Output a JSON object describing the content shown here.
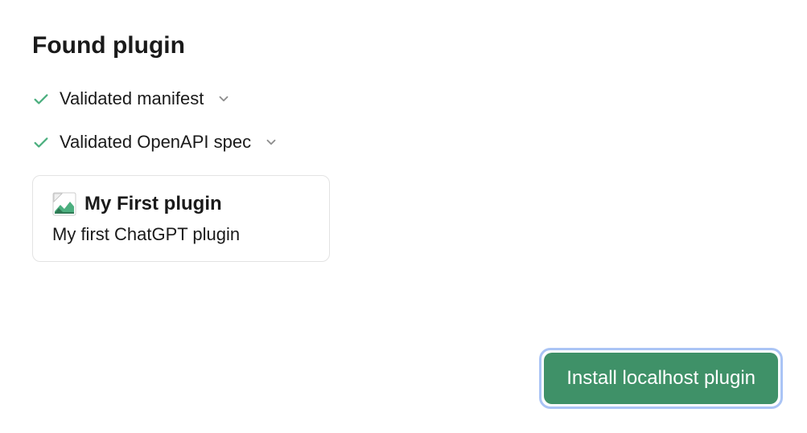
{
  "heading": "Found plugin",
  "validations": [
    {
      "label": "Validated manifest"
    },
    {
      "label": "Validated OpenAPI spec"
    }
  ],
  "plugin": {
    "name": "My First plugin",
    "description": "My first ChatGPT plugin"
  },
  "install_button_label": "Install localhost plugin",
  "colors": {
    "check": "#4caf7f",
    "chevron": "#8e8e8e",
    "button_bg": "#3f9168",
    "focus_ring": "#aac4f5"
  }
}
